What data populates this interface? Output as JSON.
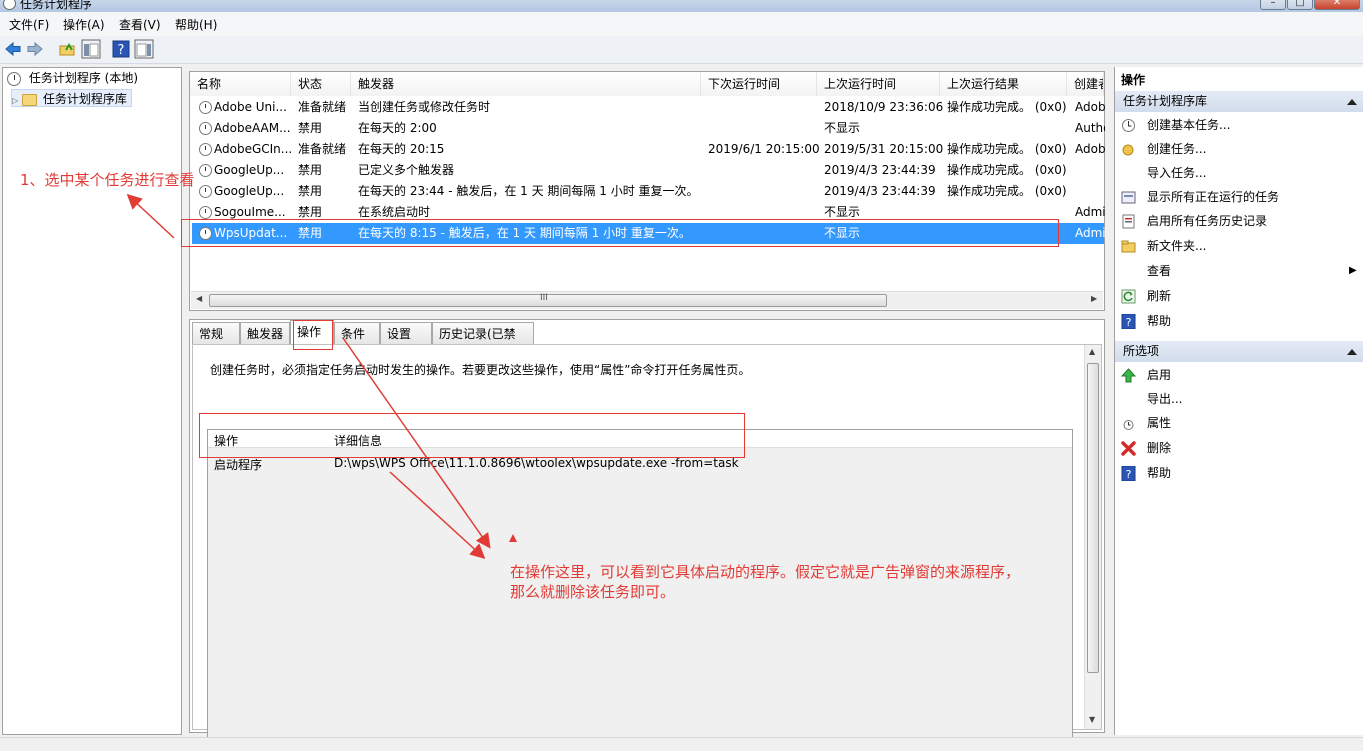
{
  "window": {
    "title": "任务计划程序"
  },
  "menu": [
    "文件(F)",
    "操作(A)",
    "查看(V)",
    "帮助(H)"
  ],
  "tree": {
    "root": "任务计划程序 (本地)",
    "library": "任务计划程序库"
  },
  "tasklist": {
    "columns": [
      "名称",
      "状态",
      "触发器",
      "下次运行时间",
      "上次运行时间",
      "上次运行结果",
      "创建者"
    ],
    "rows": [
      {
        "name": "Adobe Uni...",
        "status": "准备就绪",
        "trigger": "当创建任务或修改任务时",
        "next": "",
        "last": "2018/10/9 23:36:06",
        "result": "操作成功完成。 (0x0)",
        "author": "Adob"
      },
      {
        "name": "AdobeAAM...",
        "status": "禁用",
        "trigger": "在每天的 2:00",
        "next": "",
        "last": "不显示",
        "result": "",
        "author": "Autho"
      },
      {
        "name": "AdobeGCIn...",
        "status": "准备就绪",
        "trigger": "在每天的 20:15",
        "next": "2019/6/1 20:15:00",
        "last": "2019/5/31 20:15:00",
        "result": "操作成功完成。 (0x0)",
        "author": "Adob"
      },
      {
        "name": "GoogleUp...",
        "status": "禁用",
        "trigger": "已定义多个触发器",
        "next": "",
        "last": "2019/4/3 23:44:39",
        "result": "操作成功完成。 (0x0)",
        "author": ""
      },
      {
        "name": "GoogleUp...",
        "status": "禁用",
        "trigger": "在每天的 23:44 - 触发后，在 1 天 期间每隔 1 小时 重复一次。",
        "next": "",
        "last": "2019/4/3 23:44:39",
        "result": "操作成功完成。 (0x0)",
        "author": ""
      },
      {
        "name": "SogouIme...",
        "status": "禁用",
        "trigger": "在系统启动时",
        "next": "",
        "last": "不显示",
        "result": "",
        "author": "Admi"
      },
      {
        "name": "WpsUpdat...",
        "status": "禁用",
        "trigger": "在每天的 8:15 - 触发后，在 1 天 期间每隔 1 小时 重复一次。",
        "next": "",
        "last": "不显示",
        "result": "",
        "author": "Admi",
        "selected": true
      }
    ],
    "scroll_label": "III"
  },
  "tabs": [
    "常规",
    "触发器",
    "操作",
    "条件",
    "设置",
    "历史记录(已禁用)"
  ],
  "active_tab": 2,
  "detail": {
    "description": "创建任务时，必须指定任务启动时发生的操作。若要更改这些操作，使用“属性”命令打开任务属性页。",
    "table_headers": [
      "操作",
      "详细信息"
    ],
    "table_rows": [
      {
        "action": "启动程序",
        "details": "D:\\wps\\WPS Office\\11.1.0.8696\\wtoolex\\wpsupdate.exe -from=task"
      }
    ]
  },
  "actions_pane": {
    "title": "操作",
    "section1": "任务计划程序库",
    "items1": [
      "创建基本任务...",
      "创建任务...",
      "导入任务...",
      "显示所有正在运行的任务",
      "启用所有任务历史记录",
      "新文件夹...",
      "查看",
      "刷新",
      "帮助"
    ],
    "section2": "所选项",
    "items2": [
      "启用",
      "导出...",
      "属性",
      "删除",
      "帮助"
    ]
  },
  "annotations": {
    "step1": "1、选中某个任务进行查看",
    "note_line1": "在操作这里，可以看到它具体启动的程序。假定它就是广告弹窗的来源程序，",
    "note_line2": "那么就删除该任务即可。",
    "color": "#e23a35"
  },
  "colors": {
    "selection": "#3399ff",
    "section_header": "#d8e2f0"
  }
}
